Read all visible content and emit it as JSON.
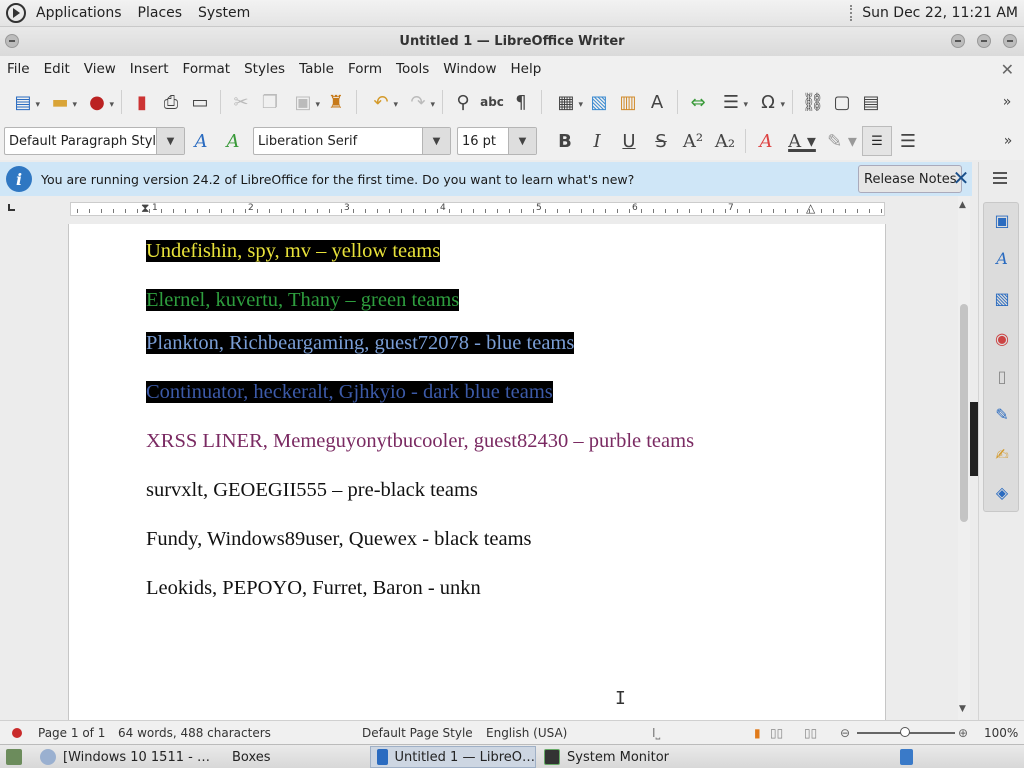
{
  "panel": {
    "applications": "Applications",
    "places": "Places",
    "system": "System",
    "clock": "Sun Dec 22, 11:21 AM"
  },
  "window": {
    "title": "Untitled 1 — LibreOffice Writer"
  },
  "menubar": {
    "items": [
      "File",
      "Edit",
      "View",
      "Insert",
      "Format",
      "Styles",
      "Table",
      "Form",
      "Tools",
      "Window",
      "Help"
    ]
  },
  "formatting": {
    "paragraph_style": "Default Paragraph Style",
    "font_name": "Liberation Serif",
    "font_size": "16 pt"
  },
  "infobar": {
    "message": "You are running version 24.2 of LibreOffice for the first time. Do you want to learn what's new?",
    "release_notes_label": "Release Notes"
  },
  "ruler": {
    "numbers": [
      "1",
      "2",
      "3",
      "4",
      "5",
      "6",
      "7"
    ]
  },
  "document": {
    "lines": [
      {
        "text": "Undefishin, spy, mv – yellow teams",
        "color": "#e8e23a",
        "highlight": true
      },
      {
        "text": "Elernel, kuvertu, Thany – green teams",
        "color": "#2e9e3e",
        "highlight": true
      },
      {
        "text": "Plankton, Richbeargaming, guest72078 - blue teams",
        "color": "#7a9ed6",
        "highlight": true
      },
      {
        "text": "Continuator, heckeralt, Gjhkyio - dark blue teams",
        "color": "#3c5aa8",
        "highlight": true
      },
      {
        "text": "XRSS LINER, Memeguyonytbucooler, guest82430 – purble teams",
        "color": "#7a2a62",
        "highlight": false
      },
      {
        "text": "survxlt, GEOEGII555 – pre-black teams",
        "color": "#111111",
        "highlight": false
      },
      {
        "text": "Fundy, Windows89user, Quewex - black teams",
        "color": "#111111",
        "highlight": false
      },
      {
        "text": "Leokids, PEPOYO, Furret, Baron - unkn",
        "color": "#111111",
        "highlight": false
      }
    ]
  },
  "statusbar": {
    "page": "Page 1 of 1",
    "words": "64 words, 488 characters",
    "page_style": "Default Page Style",
    "language": "English (USA)",
    "zoom": "100%"
  },
  "taskbar": {
    "items": [
      {
        "label": "[Windows 10 1511 - …",
        "active": false
      },
      {
        "label": "Boxes",
        "active": false
      },
      {
        "label": "Untitled 1 — LibreO…",
        "active": true
      },
      {
        "label": "System Monitor",
        "active": false
      }
    ]
  }
}
